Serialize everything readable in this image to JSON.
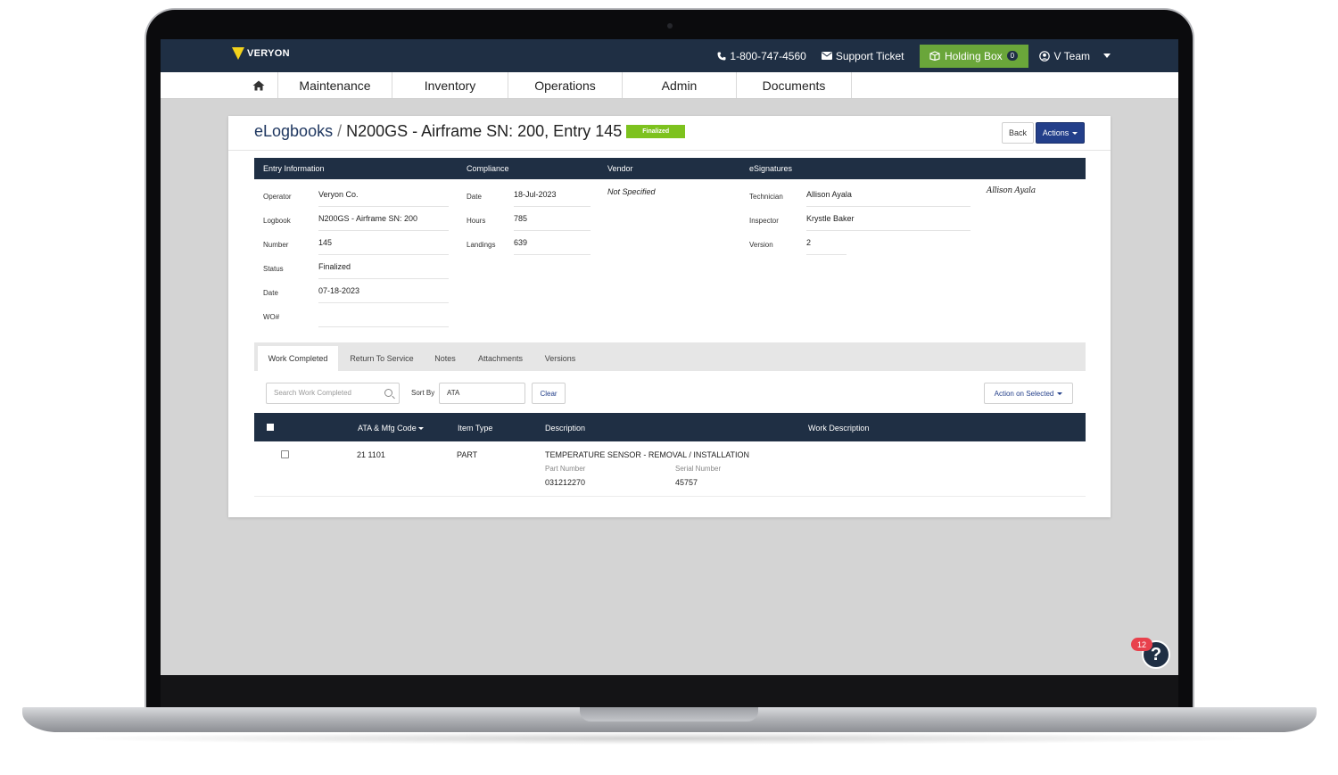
{
  "topbar": {
    "logo_text": "VERYON",
    "phone": "1-800-747-4560",
    "support_ticket": "Support Ticket",
    "holding_box": {
      "label": "Holding Box",
      "count": "0"
    },
    "user": "V Team"
  },
  "nav": {
    "items": [
      "Maintenance",
      "Inventory",
      "Operations",
      "Admin",
      "Documents"
    ]
  },
  "page": {
    "breadcrumb_root": "eLogbooks",
    "separator": "/",
    "title": "N200GS - Airframe SN: 200, Entry 145",
    "status_badge": "Finalized",
    "back_label": "Back",
    "actions_label": "Actions"
  },
  "info_header": {
    "entry_information": "Entry Information",
    "compliance": "Compliance",
    "vendor": "Vendor",
    "esignatures": "eSignatures"
  },
  "entry": {
    "operator": {
      "label": "Operator",
      "value": "Veryon Co."
    },
    "logbook": {
      "label": "Logbook",
      "value": "N200GS - Airframe SN: 200"
    },
    "number": {
      "label": "Number",
      "value": "145"
    },
    "status": {
      "label": "Status",
      "value": "Finalized"
    },
    "date": {
      "label": "Date",
      "value": "07-18-2023"
    },
    "wo": {
      "label": "WO#",
      "value": ""
    }
  },
  "compliance": {
    "date": {
      "label": "Date",
      "value": "18-Jul-2023"
    },
    "hours": {
      "label": "Hours",
      "value": "785"
    },
    "landings": {
      "label": "Landings",
      "value": "639"
    }
  },
  "vendor": {
    "value": "Not Specified"
  },
  "esignatures": {
    "technician": {
      "label": "Technician",
      "value": "Allison Ayala"
    },
    "inspector": {
      "label": "Inspector",
      "value": "Krystle Baker"
    },
    "version": {
      "label": "Version",
      "value": "2"
    },
    "signature_text": "Allison Ayala"
  },
  "tabs": [
    "Work Completed",
    "Return To Service",
    "Notes",
    "Attachments",
    "Versions"
  ],
  "toolbar": {
    "search_placeholder": "Search Work Completed",
    "sort_by_label": "Sort By",
    "sort_value": "ATA",
    "clear_label": "Clear",
    "action_on_selected": "Action on Selected"
  },
  "table": {
    "headers": [
      "ATA & Mfg Code",
      "Item Type",
      "Description",
      "Work Description"
    ],
    "rows": [
      {
        "ata": "21 1101",
        "item_type": "PART",
        "description": "TEMPERATURE SENSOR - REMOVAL / INSTALLATION",
        "part_number_label": "Part Number",
        "part_number": "031212270",
        "serial_number_label": "Serial Number",
        "serial_number": "45757"
      }
    ]
  },
  "help": {
    "badge_count": "12",
    "icon": "?"
  },
  "colors": {
    "navy": "#1f2f44",
    "accent_blue": "#233f8a",
    "holding_green": "#6aa63a",
    "finalized_green": "#7dc21e",
    "badge_red": "#e8414c"
  }
}
